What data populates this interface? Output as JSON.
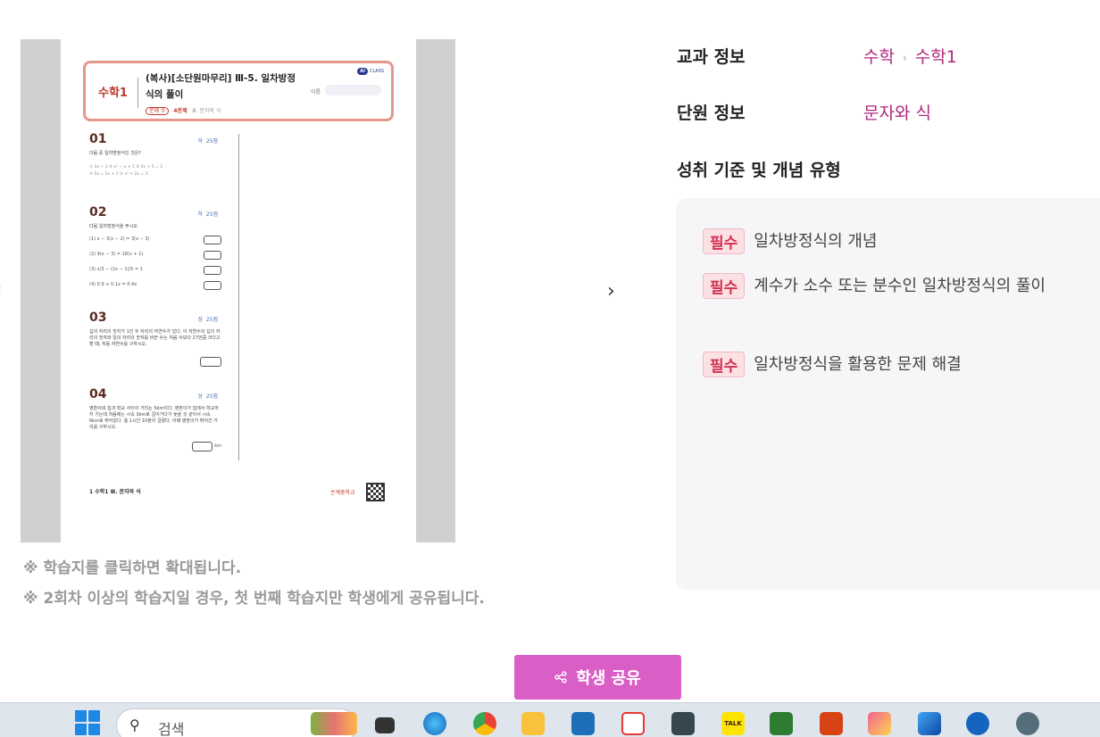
{
  "nav": {
    "prev": "‹",
    "next": "›"
  },
  "worksheet": {
    "subject": "수학1",
    "title": "(복사)[소단원마무리] Ⅲ-5. 일차방정식의 풀이",
    "count": "문제 수",
    "count_value": "4문제",
    "unit": "Ⅲ. 문자와 식",
    "logo_mark": "AI",
    "logo_text": "CLASS",
    "name_label": "이름",
    "questions": [
      {
        "num": "01",
        "level": "하",
        "score": "25점",
        "text": "다음 중 일차방정식인 것은?",
        "opts1": "① 5x − 3      ② x² − x + 1      ③ 3x + 5 = 3",
        "opts2": "④ 5x = 5x + 1      ⑤ x² + 2x = 3"
      },
      {
        "num": "02",
        "level": "하",
        "score": "25점",
        "text": "다음 일차방정식을 푸시오.",
        "lines": [
          "(1) x − 3(x − 2) = 3(x − 3)",
          "(2) 9(x − 3) = 18(x + 1)",
          "(3) x/3 − (2x − 1)/5 = 1",
          "(4) 0.9 + 0.1x = 0.4x"
        ]
      },
      {
        "num": "03",
        "level": "상",
        "score": "25점",
        "text": "십의 자리의 숫자가 1인 두 자리의 자연수가 있다. 이 자연수의 십의 자리의 숫자와 일의 자리의 숫자를 바꾼 수는 처음 수보다 27만큼 크다고 할 때, 처음 자연수를 구하시오."
      },
      {
        "num": "04",
        "level": "상",
        "score": "25점",
        "text": "영훈이네 집과 학교 사이의 거리는 5km이다. 영훈이가 집에서 학교까지 가는데 처음에는 시속 3km로 걸어가다가 늦을 것 같아서 시속 6km로 뛰어갔다. 총 1시간 10분이 걸렸다. 이때 영훈이가 뛰어간 거리를 구하시오.",
        "unit": "km"
      }
    ],
    "footer": "1  수학1 Ⅲ. 문자와 식",
    "school": "은계중학교"
  },
  "notes": [
    "※ 학습지를 클릭하면 확대됩니다.",
    "※ 2회차 이상의 학습지일 경우, 첫 번째 학습지만 학생에게 공유됩니다."
  ],
  "info": {
    "subject_label": "교과 정보",
    "subject_value_1": "수학",
    "subject_sep": "›",
    "subject_value_2": "수학1",
    "unit_label": "단원 정보",
    "unit_value": "문자와 식",
    "standard_label": "성취 기준 및 개념 유형",
    "concepts": [
      {
        "badge": "필수",
        "text": "일차방정식의 개념"
      },
      {
        "badge": "필수",
        "text": "계수가 소수 또는 분수인 일차방정식의 풀이"
      },
      {
        "badge": "필수",
        "text": "일차방정식을 활용한 문제 해결"
      }
    ]
  },
  "share": {
    "icon": "share-icon",
    "label": "학생 공유"
  },
  "taskbar": {
    "search_placeholder": "검색",
    "icons": [
      "start-icon",
      "widgets-icon",
      "task-view-icon",
      "edge-icon",
      "chrome-icon",
      "file-explorer-icon",
      "hancom-icon",
      "star-app-icon",
      "notes-icon",
      "kakaotalk-icon",
      "stock-app-icon",
      "pdf-app-icon",
      "paint-icon",
      "photos-icon",
      "teamviewer-icon",
      "settings-icon"
    ],
    "kakao_badge": "TALK"
  }
}
